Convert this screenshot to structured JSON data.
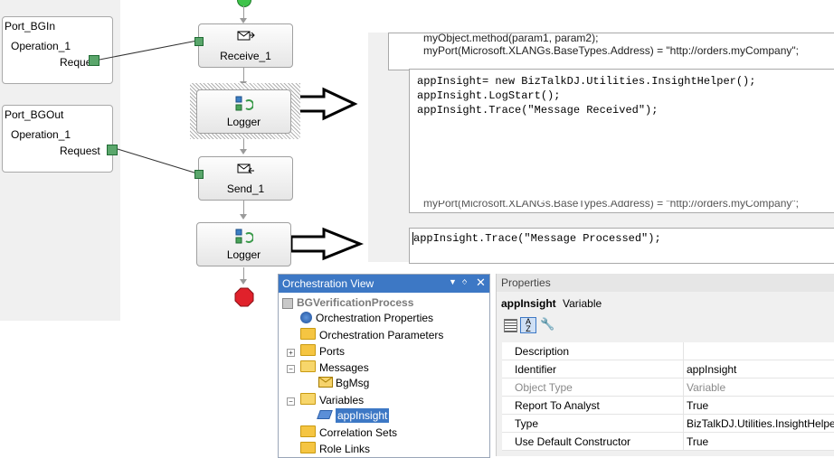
{
  "ports": {
    "in": {
      "name": "Port_BGIn",
      "operation": "Operation_1",
      "message": "Reque"
    },
    "out": {
      "name": "Port_BGOut",
      "operation": "Operation_1",
      "message": "Request"
    }
  },
  "shapes": {
    "receive": "Receive_1",
    "logger1": "Logger",
    "send": "Send_1",
    "logger2": "Logger"
  },
  "editor": {
    "ghost1": "myObject.method(param1, param2);",
    "ghost2": "myPort(Microsoft.XLANGs.BaseTypes.Address) = \"http://orders.myCompany\";",
    "code1": "appInsight= new BizTalkDJ.Utilities.InsightHelper();",
    "code2": "appInsight.LogStart();",
    "code3": "appInsight.Trace(\"Message Received\");",
    "ghost3": "myPort(Microsoft.XLANGs.BaseTypes.Address) = \"http://orders.myCompany\";",
    "code4": "appInsight.Trace(\"Message Processed\");"
  },
  "orchestration_view": {
    "title": "Orchestration View",
    "root": "BGVerificationProcess",
    "items": [
      "Orchestration Properties",
      "Orchestration Parameters",
      "Ports",
      "Messages",
      "BgMsg",
      "Variables",
      "appInsight",
      "Correlation Sets",
      "Role Links"
    ]
  },
  "properties": {
    "title": "Properties",
    "object_name": "appInsight",
    "object_type": "Variable",
    "rows": [
      {
        "key": "Description",
        "value": ""
      },
      {
        "key": "Identifier",
        "value": "appInsight"
      },
      {
        "key": "Object Type",
        "value": "Variable"
      },
      {
        "key": "Report To Analyst",
        "value": "True"
      },
      {
        "key": "Type",
        "value": "BizTalkDJ.Utilities.InsightHelper"
      },
      {
        "key": "Use Default Constructor",
        "value": "True"
      }
    ]
  },
  "colors": {
    "accent": "#3d78c5",
    "port_connector": "#5aa66b",
    "stop": "#e0212b",
    "start": "#3ec34a"
  }
}
